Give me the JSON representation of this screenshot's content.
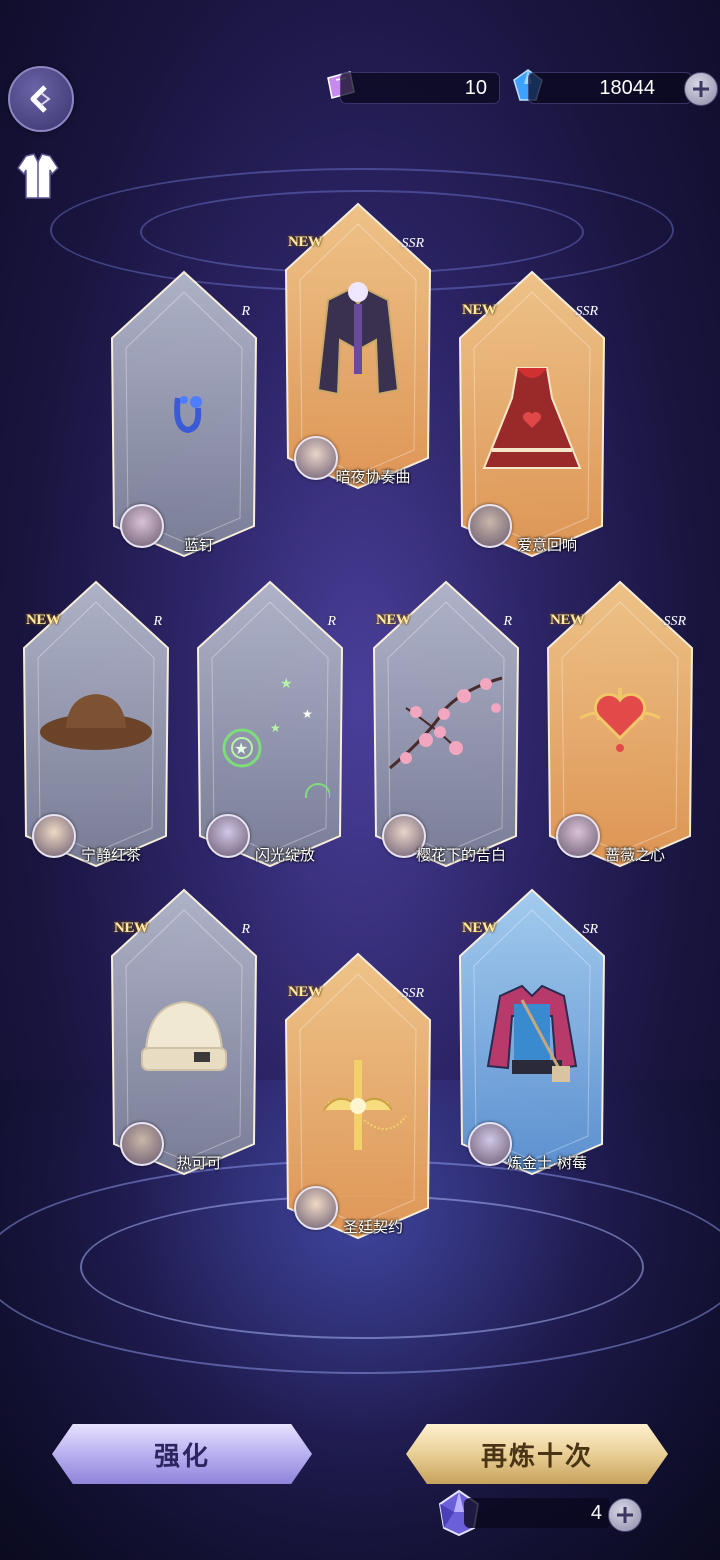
{
  "resources": {
    "tickets": "10",
    "diamonds": "18044",
    "crystals": "4"
  },
  "cards": [
    {
      "id": "c1",
      "name": "暗夜协奏曲",
      "new": "NEW",
      "rarity": "SSR",
      "tier": "gold",
      "item": "dark-coat-outfit"
    },
    {
      "id": "c2",
      "name": "蓝钉",
      "new": "",
      "rarity": "R",
      "tier": "silver",
      "item": "blue-earring"
    },
    {
      "id": "c3",
      "name": "爱意回响",
      "new": "NEW",
      "rarity": "SSR",
      "tier": "gold",
      "item": "red-heart-dress"
    },
    {
      "id": "c4",
      "name": "宁静红茶",
      "new": "NEW",
      "rarity": "R",
      "tier": "silver",
      "item": "brown-hat"
    },
    {
      "id": "c5",
      "name": "闪光绽放",
      "new": "",
      "rarity": "R",
      "tier": "silver",
      "item": "star-sparkle-effect"
    },
    {
      "id": "c6",
      "name": "樱花下的告白",
      "new": "NEW",
      "rarity": "R",
      "tier": "silver",
      "item": "cherry-blossom-branch"
    },
    {
      "id": "c7",
      "name": "蔷薇之心",
      "new": "NEW",
      "rarity": "SSR",
      "tier": "gold",
      "item": "rose-heart-brooch"
    },
    {
      "id": "c8",
      "name": "热可可",
      "new": "NEW",
      "rarity": "R",
      "tier": "silver",
      "item": "knit-beanie"
    },
    {
      "id": "c9",
      "name": "圣廷契约",
      "new": "NEW",
      "rarity": "SSR",
      "tier": "gold",
      "item": "gold-cross-brooch"
    },
    {
      "id": "c10",
      "name": "炼金士·树莓",
      "new": "NEW",
      "rarity": "SR",
      "tier": "blue",
      "item": "alchemist-outfit"
    }
  ],
  "buttons": {
    "strengthen": "强化",
    "refine_ten": "再炼十次"
  },
  "colors": {
    "gold_card": "#f0b46a",
    "silver_card": "#9aa0b8",
    "blue_card": "#7eb6ea"
  }
}
